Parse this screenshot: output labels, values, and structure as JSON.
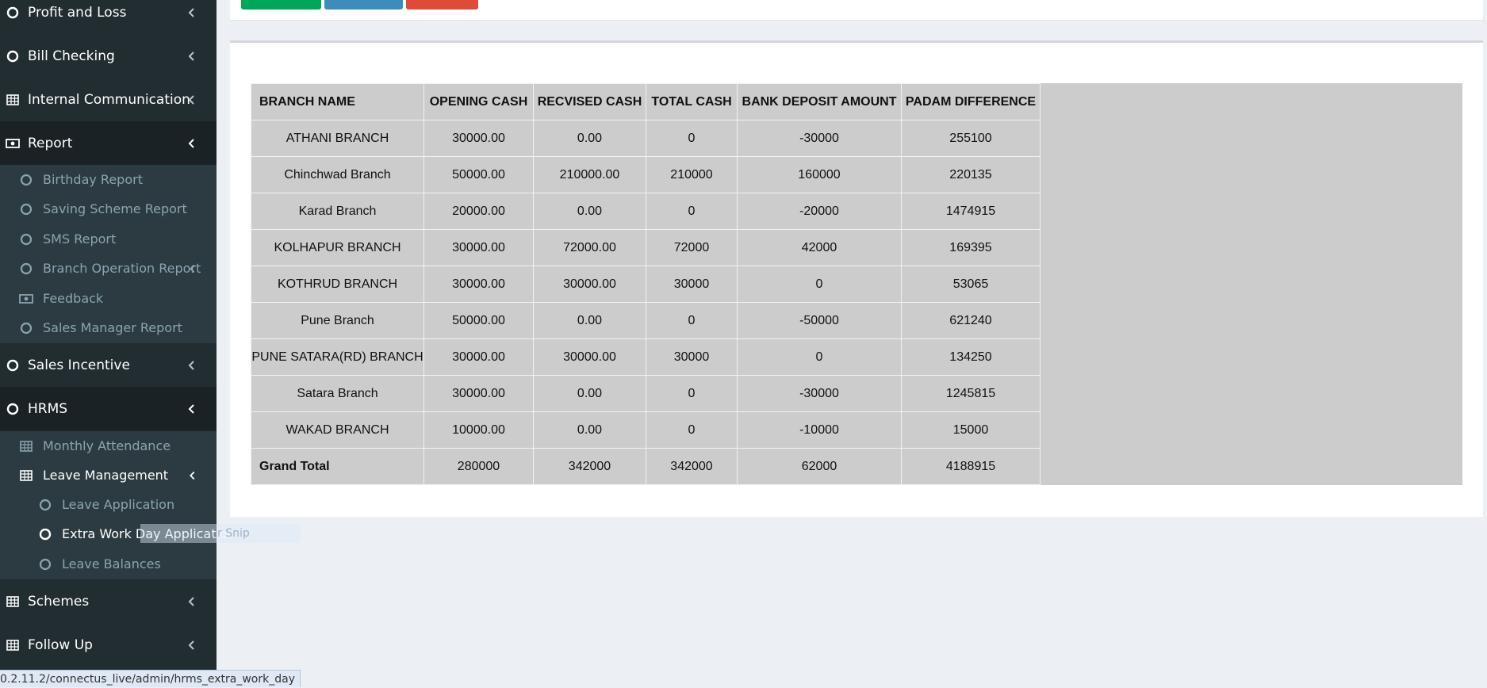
{
  "sidebar": {
    "items": [
      {
        "label": "Profit and Loss",
        "icon": "circle-icon"
      },
      {
        "label": "Bill Checking",
        "icon": "circle-icon"
      },
      {
        "label": "Internal Communication",
        "icon": "table-icon"
      },
      {
        "label": "Report",
        "icon": "money-icon"
      },
      {
        "label": "Sales Incentive",
        "icon": "circle-icon"
      },
      {
        "label": "HRMS",
        "icon": "circle-icon"
      },
      {
        "label": "Schemes",
        "icon": "table-icon"
      },
      {
        "label": "Follow Up",
        "icon": "table-icon"
      }
    ],
    "report_sub": [
      {
        "label": "Birthday Report",
        "icon": "circle-icon"
      },
      {
        "label": "Saving Scheme Report",
        "icon": "circle-icon"
      },
      {
        "label": "SMS Report",
        "icon": "circle-icon"
      },
      {
        "label": "Branch Operation Report",
        "icon": "circle-icon"
      },
      {
        "label": "Feedback",
        "icon": "money-icon"
      },
      {
        "label": "Sales Manager Report",
        "icon": "circle-icon"
      }
    ],
    "hrms_sub": [
      {
        "label": "Monthly Attendance",
        "icon": "table-icon"
      },
      {
        "label": "Leave Management",
        "icon": "table-icon"
      }
    ],
    "leave_sub": [
      {
        "label": "Leave Application",
        "icon": "circle-icon"
      },
      {
        "label": "Extra Work Day Application",
        "icon": "circle-icon"
      },
      {
        "label": "Leave Balances",
        "icon": "circle-icon"
      }
    ],
    "snip_text": "r Snip"
  },
  "table": {
    "headers": [
      "BRANCH NAME",
      "OPENING CASH",
      "RECVISED CASH",
      "TOTAL CASH",
      "BANK DEPOSIT AMOUNT",
      "PADAM DIFFERENCE"
    ],
    "rows": [
      [
        "ATHANI BRANCH",
        "30000.00",
        "0.00",
        "0",
        "-30000",
        "255100"
      ],
      [
        "Chinchwad Branch",
        "50000.00",
        "210000.00",
        "210000",
        "160000",
        "220135"
      ],
      [
        "Karad Branch",
        "20000.00",
        "0.00",
        "0",
        "-20000",
        "1474915"
      ],
      [
        "KOLHAPUR BRANCH",
        "30000.00",
        "72000.00",
        "72000",
        "42000",
        "169395"
      ],
      [
        "KOTHRUD BRANCH",
        "30000.00",
        "30000.00",
        "30000",
        "0",
        "53065"
      ],
      [
        "Pune Branch",
        "50000.00",
        "0.00",
        "0",
        "-50000",
        "621240"
      ],
      [
        "PUNE SATARA(RD) BRANCH",
        "30000.00",
        "30000.00",
        "30000",
        "0",
        "134250"
      ],
      [
        "Satara Branch",
        "30000.00",
        "0.00",
        "0",
        "-30000",
        "1245815"
      ],
      [
        "WAKAD BRANCH",
        "10000.00",
        "0.00",
        "0",
        "-10000",
        "15000"
      ]
    ],
    "total": [
      "Grand Total",
      "280000",
      "342000",
      "342000",
      "62000",
      "4188915"
    ]
  },
  "status_url": "0.2.11.2/connectus_live/admin/hrms_extra_work_day",
  "colors": {
    "sidebar_bg": "#222d32",
    "submenu_bg": "#2c3b41",
    "green": "#00a65a",
    "blue": "#3c8dbc",
    "red": "#dd4b39"
  }
}
